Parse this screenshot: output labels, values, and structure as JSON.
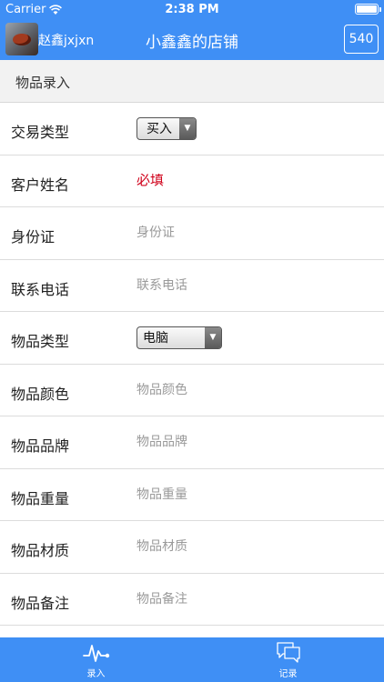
{
  "status_bar": {
    "carrier": "Carrier",
    "time": "2:38 PM"
  },
  "nav": {
    "owner": "赵鑫jxjxn",
    "title": "小鑫鑫的店铺",
    "count": "540"
  },
  "section": {
    "title": "物品录入"
  },
  "form": {
    "trade_type": {
      "label": "交易类型",
      "value": "买入"
    },
    "customer_name": {
      "label": "客户姓名",
      "placeholder": "必填"
    },
    "id_card": {
      "label": "身份证",
      "placeholder": "身份证"
    },
    "phone": {
      "label": "联系电话",
      "placeholder": "联系电话"
    },
    "item_type": {
      "label": "物品类型",
      "value": "电脑"
    },
    "color": {
      "label": "物品颜色",
      "placeholder": "物品颜色"
    },
    "brand": {
      "label": "物品品牌",
      "placeholder": "物品品牌"
    },
    "weight": {
      "label": "物品重量",
      "placeholder": "物品重量"
    },
    "material": {
      "label": "物品材质",
      "placeholder": "物品材质"
    },
    "note": {
      "label": "物品备注",
      "placeholder": "物品备注"
    }
  },
  "tabs": [
    {
      "label": "录入",
      "icon": "pulse-icon"
    },
    {
      "label": "记录",
      "icon": "chat-bubbles-icon"
    }
  ],
  "colors": {
    "accent": "#3f8ff5",
    "required": "#d0021b",
    "placeholder": "#9a9a9a"
  }
}
